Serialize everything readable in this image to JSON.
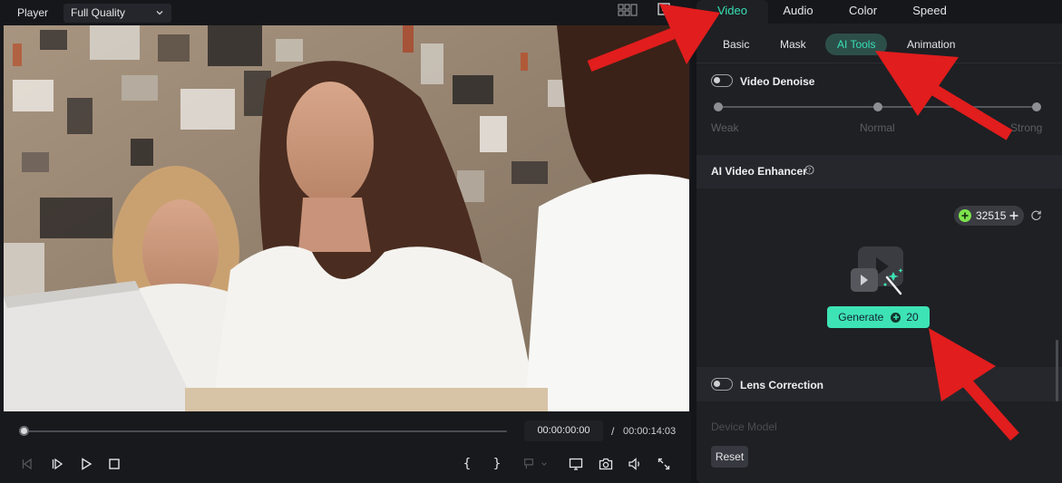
{
  "player": {
    "label": "Player",
    "quality": "Full Quality",
    "time_current": "00:00:00:00",
    "time_separator": "/",
    "time_total": "00:00:14:03",
    "progress": 0.0,
    "controls": {
      "open_brace": "{",
      "close_brace": "}"
    }
  },
  "panel": {
    "main_tabs": [
      "Video",
      "Audio",
      "Color",
      "Speed"
    ],
    "active_main_tab": "Video",
    "sub_tabs": [
      "Basic",
      "Mask",
      "AI Tools",
      "Animation"
    ],
    "active_sub_tab": "AI Tools",
    "denoise": {
      "title": "Video Denoise",
      "enabled": false,
      "levels": [
        "Weak",
        "Normal",
        "Strong"
      ]
    },
    "enhancer": {
      "title": "AI Video Enhancer",
      "credits": "32515",
      "generate_label": "Generate",
      "generate_cost": "20"
    },
    "lens": {
      "title": "Lens Correction",
      "enabled": false,
      "device_model_label": "Device Model"
    },
    "reset_label": "Reset"
  },
  "colors": {
    "accent": "#37e0b4",
    "generate_bg": "#3ee3b5",
    "annotation_red": "#e11d1d"
  },
  "icons": [
    "chevron-down-icon",
    "grid-view-icon",
    "fullscreen-preview-icon",
    "prev-frame-icon",
    "play-frame-icon",
    "play-icon",
    "stop-icon",
    "marker-icon",
    "display-icon",
    "snapshot-icon",
    "volume-icon",
    "expand-icon",
    "help-icon",
    "credit-coin-icon",
    "plus-icon",
    "refresh-icon",
    "ai-enhance-icon"
  ]
}
